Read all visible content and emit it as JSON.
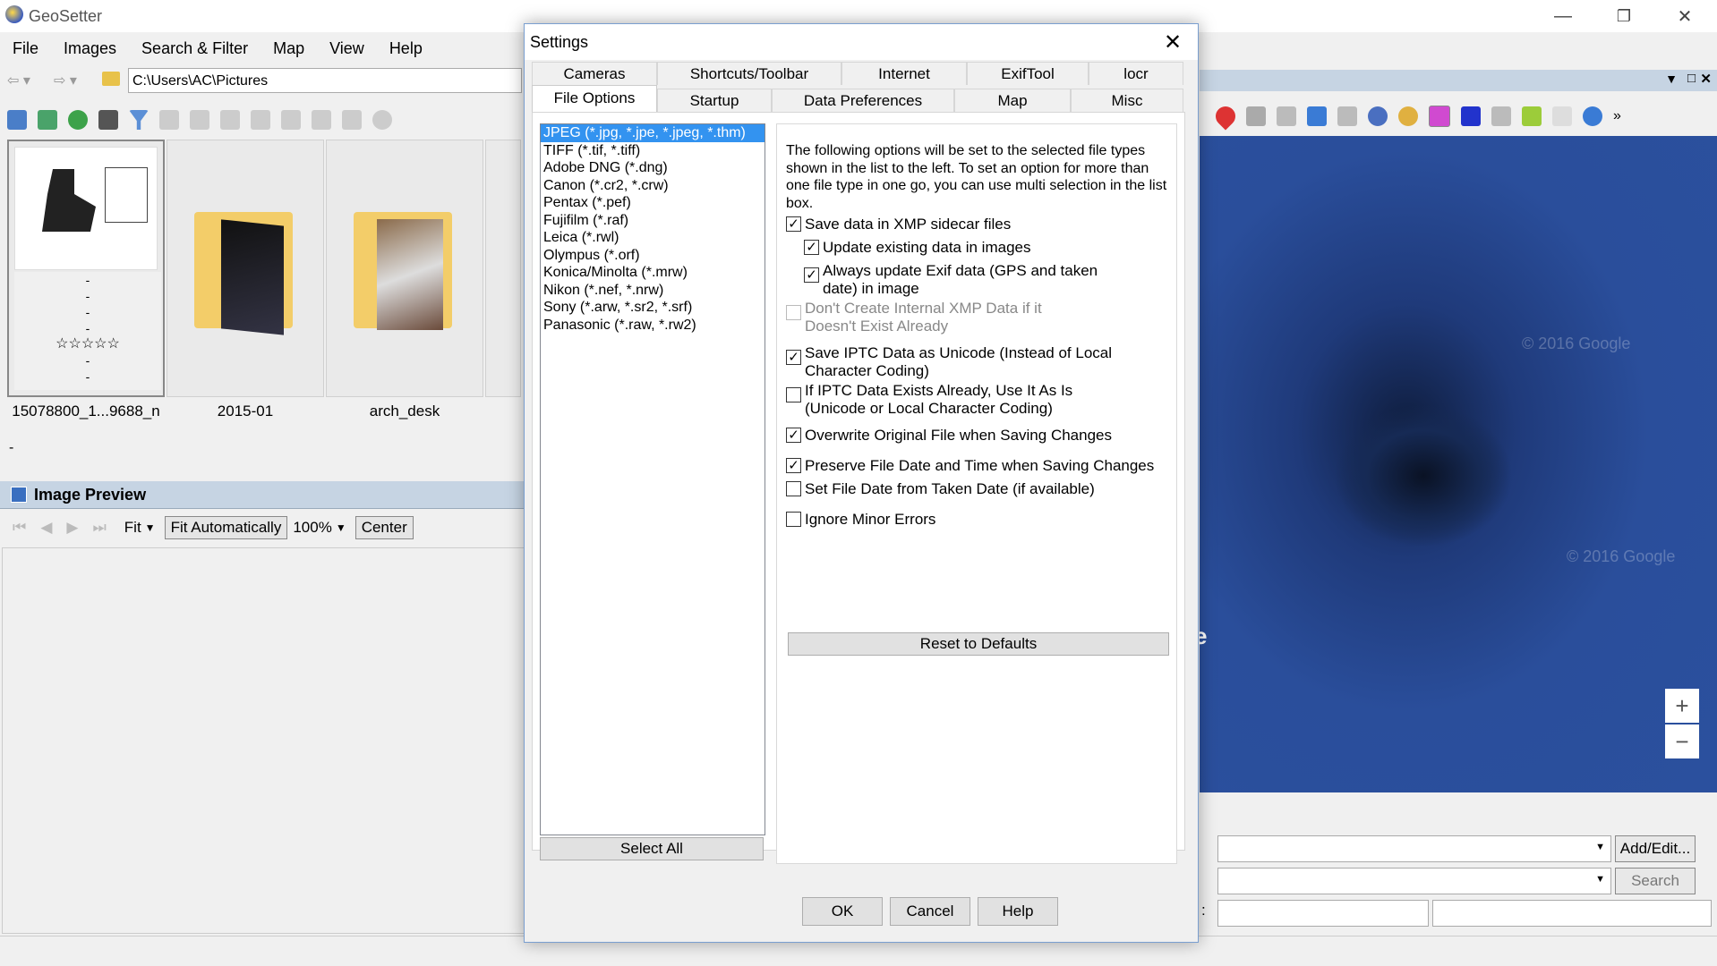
{
  "app": {
    "title": "GeoSetter",
    "logo_icon": "globe-icon"
  },
  "window_controls": {
    "minimize": "—",
    "restore": "❐",
    "close": "✕"
  },
  "menu": [
    "File",
    "Images",
    "Search & Filter",
    "Map",
    "View",
    "Help"
  ],
  "address": {
    "path": "C:\\Users\\AC\\Pictures"
  },
  "thumbnails": [
    {
      "label": "15078800_1...9688_n",
      "rating_stars": "☆☆☆☆☆",
      "meta": [
        "-",
        "-",
        "-",
        "-",
        "-",
        "-"
      ]
    },
    {
      "label": "2015-01"
    },
    {
      "label": "arch_desk"
    }
  ],
  "thumb_status": "-",
  "preview": {
    "title": "Image Preview",
    "fit_label": "Fit",
    "fit_auto_label": "Fit Automatically",
    "zoom_value": "100%",
    "center_label": "Center"
  },
  "map": {
    "watermark": "© 2016 Google",
    "zoom_in": "+",
    "zoom_out": "−",
    "google_fragment": "e"
  },
  "right_panel": {
    "add_edit_label": "Add/Edit...",
    "search_label": "Search",
    "colon": ":"
  },
  "dialog": {
    "title": "Settings",
    "close_icon": "✕",
    "tabs_row1": [
      "Cameras",
      "Shortcuts/Toolbar",
      "Internet",
      "ExifTool",
      "locr"
    ],
    "tabs_row2": [
      "File Options",
      "Startup",
      "Data Preferences",
      "Map",
      "Misc"
    ],
    "active_tab": "File Options",
    "file_types": [
      "JPEG (*.jpg, *.jpe, *.jpeg, *.thm)",
      "TIFF (*.tif, *.tiff)",
      "Adobe DNG (*.dng)",
      "Canon (*.cr2, *.crw)",
      "Pentax (*.pef)",
      "Fujifilm (*.raf)",
      "Leica (*.rwl)",
      "Olympus (*.orf)",
      "Konica/Minolta (*.mrw)",
      "Nikon (*.nef, *.nrw)",
      "Sony (*.arw, *.sr2, *.srf)",
      "Panasonic (*.raw, *.rw2)"
    ],
    "select_all_label": "Select All",
    "description": "The following options will be set to the selected file types shown in the list to the left. To set an option for more than one file type in one go, you can use multi selection in the list box.",
    "options": [
      {
        "label": "Save data in XMP sidecar files",
        "checked": true
      },
      {
        "label": "Update existing data in images",
        "checked": true
      },
      {
        "label": "Always update Exif data (GPS and taken date) in image",
        "checked": true
      },
      {
        "label": "Don't Create Internal XMP Data if it Doesn't Exist Already",
        "checked": false
      },
      {
        "label": "Save IPTC Data as Unicode (Instead of Local Character Coding)",
        "checked": true
      },
      {
        "label": "If IPTC Data Exists Already, Use It As Is (Unicode or Local Character Coding)",
        "checked": false
      },
      {
        "label": "Overwrite Original File when Saving Changes",
        "checked": true
      },
      {
        "label": "Preserve File Date and Time when Saving Changes",
        "checked": true
      },
      {
        "label": "Set File Date from Taken Date (if available)",
        "checked": false
      },
      {
        "label": "Ignore Minor Errors",
        "checked": false
      }
    ],
    "check_mark": "✓",
    "reset_label": "Reset to Defaults",
    "ok_label": "OK",
    "cancel_label": "Cancel",
    "help_label": "Help"
  }
}
